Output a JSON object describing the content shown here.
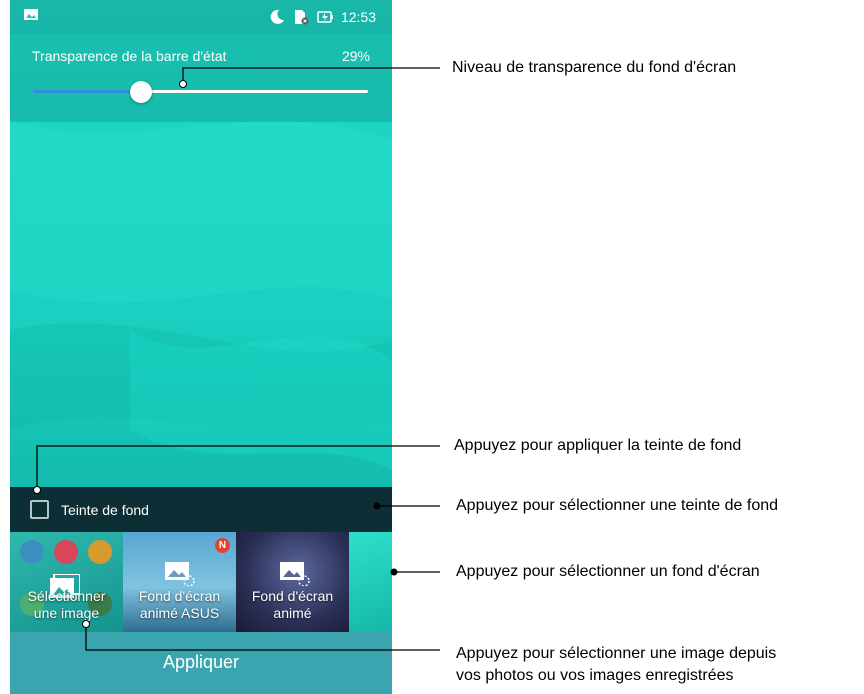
{
  "status_bar": {
    "time": "12:53",
    "icons": [
      "gallery-icon",
      "moon-icon",
      "sim-icon",
      "battery-charging-icon"
    ]
  },
  "transparency": {
    "label": "Transparence de la barre d'état",
    "value_text": "29%",
    "value": 0.29
  },
  "tint": {
    "label": "Teinte de fond",
    "checked": false
  },
  "thumbnails": [
    {
      "label_line1": "Sélectionner",
      "label_line2": "une image"
    },
    {
      "label_line1": "Fond d'écran",
      "label_line2": "animé ASUS",
      "badge": "N"
    },
    {
      "label_line1": "Fond d'écran",
      "label_line2": "animé"
    }
  ],
  "apply": {
    "label": "Appliquer"
  },
  "callouts": {
    "transparency": "Niveau de transparence du fond d'écran",
    "apply_tint": "Appuyez pour appliquer la teinte de fond",
    "select_tint": "Appuyez pour sélectionner une teinte de fond",
    "select_wallpaper": "Appuyez pour sélectionner un fond d'écran",
    "select_image_line1": "Appuyez pour sélectionner une image depuis",
    "select_image_line2": "vos photos ou vos images enregistrées"
  },
  "colors": {
    "wallpaper": "#1fd8c5",
    "tint_bar": "#0d2e34",
    "apply_bar": "#3aa5ae",
    "slider_fill": "#2f8fe0"
  }
}
